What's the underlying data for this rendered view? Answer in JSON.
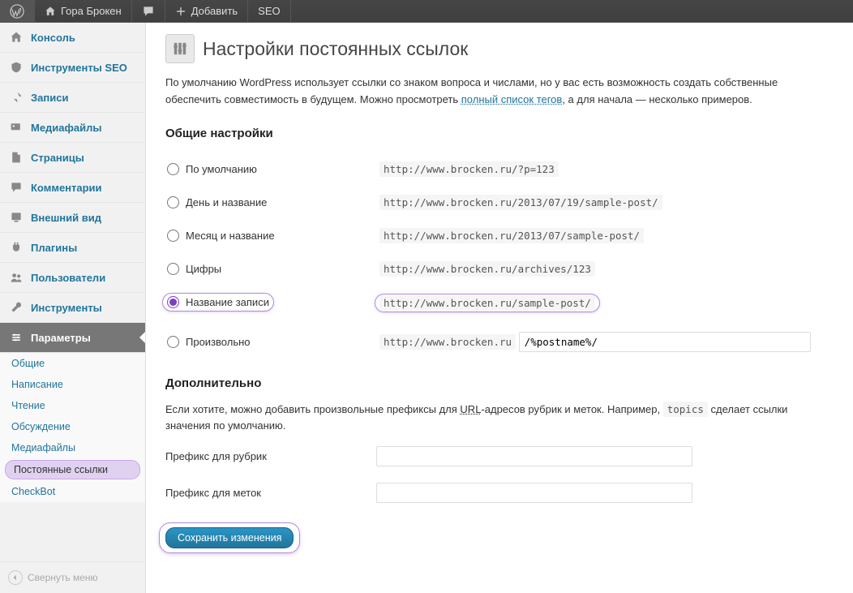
{
  "adminbar": {
    "site_name": "Гора Брокен",
    "comments": "",
    "add_new": "Добавить",
    "seo": "SEO"
  },
  "sidebar": {
    "items": [
      {
        "label": "Консоль",
        "icon": "home"
      },
      {
        "label": "Инструменты SEO",
        "icon": "shield"
      },
      {
        "label": "Записи",
        "icon": "pin"
      },
      {
        "label": "Медиафайлы",
        "icon": "media"
      },
      {
        "label": "Страницы",
        "icon": "page"
      },
      {
        "label": "Комментарии",
        "icon": "comment"
      },
      {
        "label": "Внешний вид",
        "icon": "appearance"
      },
      {
        "label": "Плагины",
        "icon": "plugin"
      },
      {
        "label": "Пользователи",
        "icon": "users"
      },
      {
        "label": "Инструменты",
        "icon": "tools"
      },
      {
        "label": "Параметры",
        "icon": "settings",
        "current": true
      }
    ],
    "submenu": [
      {
        "label": "Общие"
      },
      {
        "label": "Написание"
      },
      {
        "label": "Чтение"
      },
      {
        "label": "Обсуждение"
      },
      {
        "label": "Медиафайлы"
      },
      {
        "label": "Постоянные ссылки",
        "current": true
      },
      {
        "label": "CheckBot"
      }
    ],
    "collapse": "Свернуть меню"
  },
  "page": {
    "title": "Настройки постоянных ссылок",
    "intro_1": "По умолчанию WordPress использует ссылки со знаком вопроса и числами, но у вас есть возможность создать собственные обеспечить совместимость в будущем. Можно просмотреть ",
    "intro_link": "полный список тегов",
    "intro_2": ", а для начала — несколько примеров.",
    "section_common": "Общие настройки",
    "options": [
      {
        "label": "По умолчанию",
        "example": "http://www.brocken.ru/?p=123"
      },
      {
        "label": "День и название",
        "example": "http://www.brocken.ru/2013/07/19/sample-post/"
      },
      {
        "label": "Месяц и название",
        "example": "http://www.brocken.ru/2013/07/sample-post/"
      },
      {
        "label": "Цифры",
        "example": "http://www.brocken.ru/archives/123"
      },
      {
        "label": "Название записи",
        "example": "http://www.brocken.ru/sample-post/",
        "selected": true
      },
      {
        "label": "Произвольно",
        "custom": true,
        "base": "http://www.brocken.ru",
        "value": "/%postname%/"
      }
    ],
    "section_optional": "Дополнительно",
    "optional_text_1": "Если хотите, можно добавить произвольные префиксы для ",
    "optional_url": "URL",
    "optional_text_2": "-адресов рубрик и меток. Например, ",
    "optional_code": "topics",
    "optional_text_3": " сделает ссылки значения по умолчанию.",
    "category_label": "Префикс для рубрик",
    "category_value": "",
    "tag_label": "Префикс для меток",
    "tag_value": "",
    "submit": "Сохранить изменения"
  }
}
